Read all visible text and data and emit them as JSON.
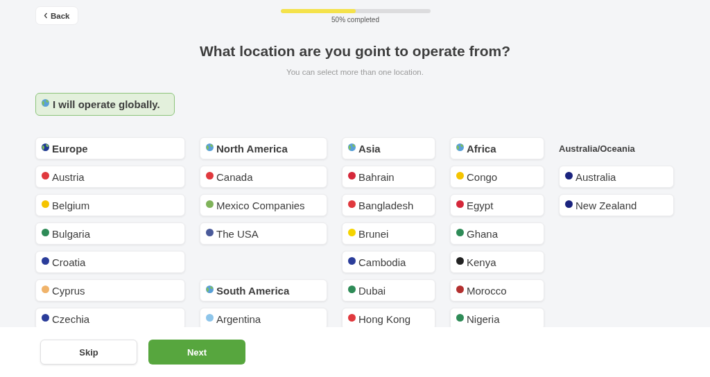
{
  "back_button": {
    "label": "Back"
  },
  "progress": {
    "level": 0.5,
    "label": "50% completed"
  },
  "title": "What location are you goint to operate from?",
  "subtitle": "You can select more than one location.",
  "global_option": {
    "label": "I will operate globally.",
    "selected": true
  },
  "columns": [
    {
      "groups": [
        {
          "items": [
            {
              "label": "Europe",
              "kind": "region",
              "color": "#1f3a93",
              "selected": false
            },
            {
              "label": "Austria",
              "kind": "country",
              "color": "#e0393e",
              "selected": false
            },
            {
              "label": "Belgium",
              "kind": "country",
              "color": "#f5c400",
              "selected": false
            },
            {
              "label": "Bulgaria",
              "kind": "country",
              "color": "#2e8b57",
              "selected": false
            },
            {
              "label": "Croatia",
              "kind": "country",
              "color": "#2b3d9a",
              "selected": false
            },
            {
              "label": "Cyprus",
              "kind": "country",
              "color": "#f0b36a",
              "selected": false
            },
            {
              "label": "Czechia",
              "kind": "country",
              "color": "#2b3d9a",
              "selected": false
            }
          ]
        }
      ]
    },
    {
      "groups": [
        {
          "items": [
            {
              "label": "North America",
              "kind": "region",
              "color": "#5aa0d8",
              "selected": false
            },
            {
              "label": "Canada",
              "kind": "country",
              "color": "#e0393e",
              "selected": false
            },
            {
              "label": "Mexico Companies",
              "kind": "country",
              "color": "#7fb35a",
              "selected": false
            },
            {
              "label": "The USA",
              "kind": "country",
              "color": "#4a5a9a",
              "selected": false
            }
          ]
        },
        {
          "items": [
            {
              "label": "South America",
              "kind": "region",
              "color": "#5aa0d8",
              "selected": false
            },
            {
              "label": "Argentina",
              "kind": "country",
              "color": "#8ec5ea",
              "selected": false
            }
          ]
        }
      ]
    },
    {
      "groups": [
        {
          "items": [
            {
              "label": "Asia",
              "kind": "region",
              "color": "#5aa0d8",
              "selected": false
            },
            {
              "label": "Bahrain",
              "kind": "country",
              "color": "#d5283a",
              "selected": false
            },
            {
              "label": "Bangladesh",
              "kind": "country",
              "color": "#e0393e",
              "selected": false
            },
            {
              "label": "Brunei",
              "kind": "country",
              "color": "#f5d400",
              "selected": false
            },
            {
              "label": "Cambodia",
              "kind": "country",
              "color": "#2b3d9a",
              "selected": false
            },
            {
              "label": "Dubai",
              "kind": "country",
              "color": "#2e8b57",
              "selected": false
            },
            {
              "label": "Hong Kong",
              "kind": "country",
              "color": "#e0393e",
              "selected": false
            }
          ]
        }
      ]
    },
    {
      "groups": [
        {
          "items": [
            {
              "label": "Africa",
              "kind": "region",
              "color": "#5aa0d8",
              "selected": false
            },
            {
              "label": "Congo",
              "kind": "country",
              "color": "#f5c400",
              "selected": false
            },
            {
              "label": "Egypt",
              "kind": "country",
              "color": "#d5283a",
              "selected": false
            },
            {
              "label": "Ghana",
              "kind": "country",
              "color": "#2e8b57",
              "selected": false
            },
            {
              "label": "Kenya",
              "kind": "country",
              "color": "#222222",
              "selected": false
            },
            {
              "label": "Morocco",
              "kind": "country",
              "color": "#b3302f",
              "selected": false
            },
            {
              "label": "Nigeria",
              "kind": "country",
              "color": "#2e8b57",
              "selected": false
            }
          ]
        }
      ]
    },
    {
      "groups": [
        {
          "heading": "Australia/Oceania",
          "items": [
            {
              "label": "Australia",
              "kind": "country",
              "color": "#1a237e",
              "selected": false
            },
            {
              "label": "New Zealand",
              "kind": "country",
              "color": "#1a237e",
              "selected": false
            }
          ]
        }
      ]
    }
  ],
  "footer": {
    "skip_button": "Skip",
    "next_button": "Next"
  }
}
